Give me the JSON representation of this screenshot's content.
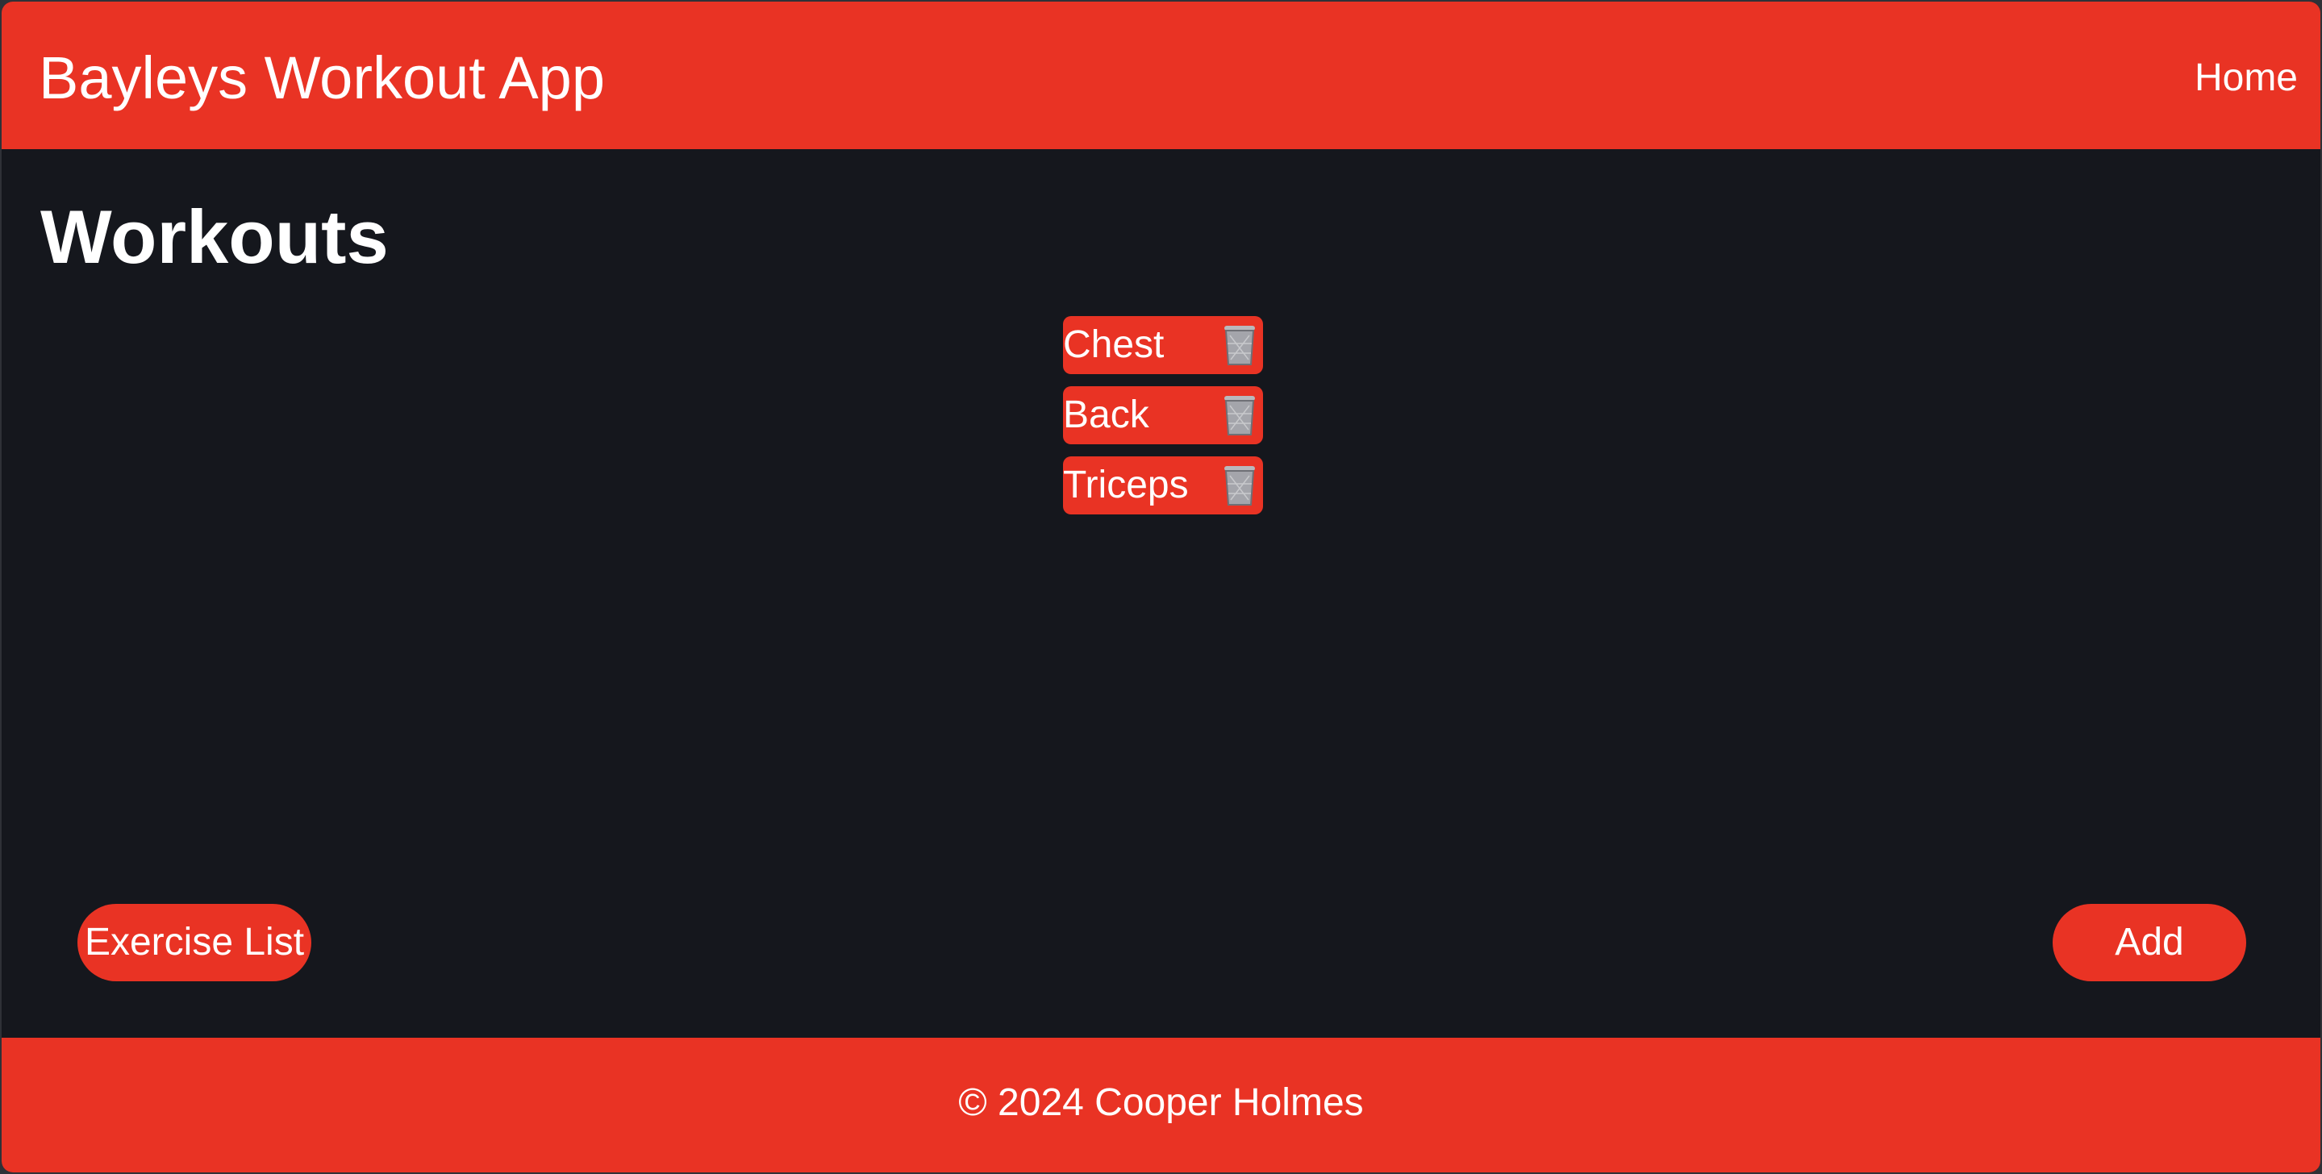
{
  "header": {
    "app_title": "Bayleys Workout App",
    "nav_home": "Home"
  },
  "main": {
    "page_title": "Workouts",
    "workouts": [
      {
        "label": "Chest",
        "action_icon": "trash-can-icon"
      },
      {
        "label": "Back",
        "action_icon": "trash-can-icon"
      },
      {
        "label": "Triceps",
        "action_icon": "trash-can-icon"
      }
    ],
    "exercise_list_label": "Exercise List",
    "add_label": "Add"
  },
  "footer": {
    "copyright": "© 2024 Cooper Holmes"
  },
  "colors": {
    "accent": "#e93324",
    "background": "#15171d",
    "text": "#ffffff"
  }
}
